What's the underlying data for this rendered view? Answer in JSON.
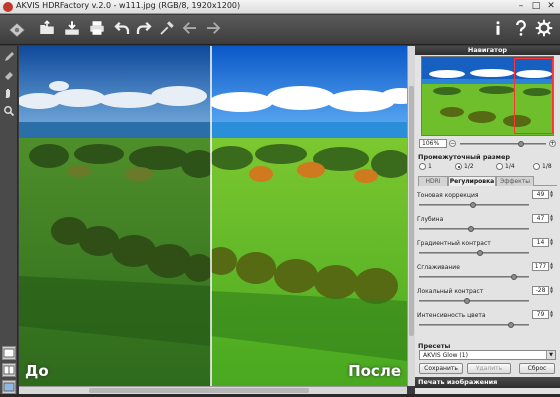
{
  "window": {
    "title": "AKVIS HDRFactory v.2.0 - w111.jpg (RGB/8, 1920x1200)",
    "min_label": "–",
    "max_label": "□",
    "close_label": "✕"
  },
  "toolbar": {
    "items": [
      "logo-icon",
      "open-icon",
      "save-icon",
      "print-icon",
      "undo-icon",
      "redo-icon",
      "eyedropper-icon",
      "back-icon",
      "forward-icon"
    ],
    "right_items": [
      "info-icon",
      "help-icon",
      "settings-icon"
    ]
  },
  "canvas": {
    "before_label": "До",
    "after_label": "После"
  },
  "panel": {
    "navigator": {
      "title": "Навигатор",
      "zoom": "106%",
      "zoom_minus": "−",
      "zoom_plus": "+",
      "zoom_level": 0.72
    },
    "intermediate": {
      "title": "Промежуточный размер",
      "options": [
        "1",
        "1/2",
        "1/4",
        "1/8"
      ],
      "selected": "1/2"
    },
    "tabs": [
      {
        "label": "HDRI"
      },
      {
        "label": "Регулировка"
      },
      {
        "label": "Эффекты"
      }
    ],
    "active_tab": "Регулировка",
    "params": [
      {
        "label": "Тоновая коррекция",
        "value": "49",
        "level": 0.49
      },
      {
        "label": "Глубина",
        "value": "47",
        "level": 0.47
      },
      {
        "label": "Градиентный контраст",
        "value": "14",
        "level": 0.56
      },
      {
        "label": "Сглаживание",
        "value": "177",
        "level": 0.88
      },
      {
        "label": "Локальный контраст",
        "value": "-28",
        "level": 0.43
      },
      {
        "label": "Интенсивность цвета",
        "value": "79",
        "level": 0.86
      }
    ],
    "presets": {
      "title": "Пресеты",
      "selected": "AKVIS Glow (1)",
      "save": "Сохранить",
      "delete": "Удалить",
      "reset": "Сброс"
    },
    "print_section": "Печать изображения"
  },
  "colors": {
    "panel_bg": "#e3e3e3",
    "toolbar_bg": "#4a4a4a",
    "grass": "#5aa82a"
  }
}
